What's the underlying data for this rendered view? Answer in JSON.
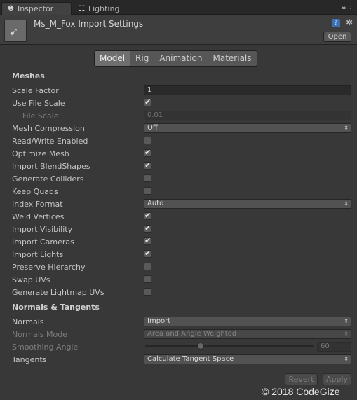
{
  "window": {
    "tabs": [
      {
        "label": "Inspector",
        "icon": "info-icon",
        "active": true
      },
      {
        "label": "Lighting",
        "icon": "grid-icon",
        "active": false
      }
    ]
  },
  "header": {
    "title": "Ms_M_Fox Import Settings",
    "open_label": "Open"
  },
  "subtabs": [
    "Model",
    "Rig",
    "Animation",
    "Materials"
  ],
  "meshes": {
    "section": "Meshes",
    "scale_factor": {
      "label": "Scale Factor",
      "value": "1"
    },
    "use_file_scale": {
      "label": "Use File Scale",
      "checked": true
    },
    "file_scale": {
      "label": "File Scale",
      "value": "0.01"
    },
    "mesh_compression": {
      "label": "Mesh Compression",
      "value": "Off"
    },
    "read_write": {
      "label": "Read/Write Enabled",
      "checked": false
    },
    "optimize_mesh": {
      "label": "Optimize Mesh",
      "checked": true
    },
    "import_blendshapes": {
      "label": "Import BlendShapes",
      "checked": true
    },
    "generate_colliders": {
      "label": "Generate Colliders",
      "checked": false
    },
    "keep_quads": {
      "label": "Keep Quads",
      "checked": false
    },
    "index_format": {
      "label": "Index Format",
      "value": "Auto"
    },
    "weld_vertices": {
      "label": "Weld Vertices",
      "checked": true
    },
    "import_visibility": {
      "label": "Import Visibility",
      "checked": true
    },
    "import_cameras": {
      "label": "Import Cameras",
      "checked": true
    },
    "import_lights": {
      "label": "Import Lights",
      "checked": true
    },
    "preserve_hierarchy": {
      "label": "Preserve Hierarchy",
      "checked": false
    },
    "swap_uvs": {
      "label": "Swap UVs",
      "checked": false
    },
    "generate_lightmap_uvs": {
      "label": "Generate Lightmap UVs",
      "checked": false
    }
  },
  "normals": {
    "section": "Normals & Tangents",
    "normals": {
      "label": "Normals",
      "value": "Import"
    },
    "normals_mode": {
      "label": "Normals Mode",
      "value": "Area and Angle Weighted"
    },
    "smoothing_angle": {
      "label": "Smoothing Angle",
      "value": "60",
      "level": 0.33
    },
    "tangents": {
      "label": "Tangents",
      "value": "Calculate Tangent Space"
    }
  },
  "footer": {
    "revert_label": "Revert",
    "apply_label": "Apply"
  },
  "watermark": "© 2018 CodeGize"
}
